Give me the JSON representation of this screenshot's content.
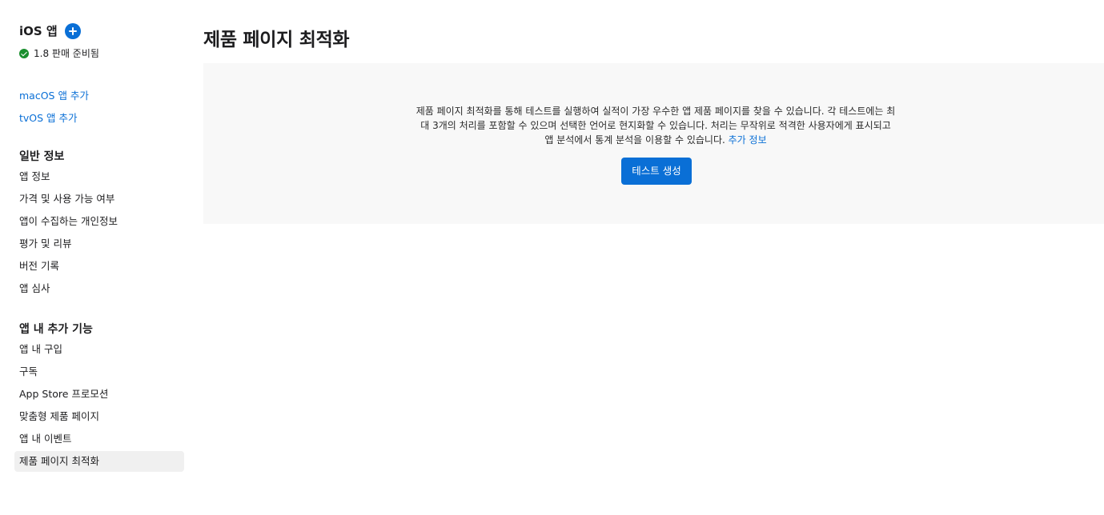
{
  "sidebar": {
    "app_title": "iOS 앱",
    "add_button_icon": "plus-circle-icon",
    "status": {
      "icon": "check-circle-icon",
      "text": "1.8 판매 준비됨"
    },
    "links": [
      {
        "label": "macOS 앱 추가"
      },
      {
        "label": "tvOS 앱 추가"
      }
    ],
    "general": {
      "title": "일반 정보",
      "items": [
        {
          "label": "앱 정보"
        },
        {
          "label": "가격 및 사용 가능 여부"
        },
        {
          "label": "앱이 수집하는 개인정보"
        },
        {
          "label": "평가 및 리뷰"
        },
        {
          "label": "버전 기록"
        },
        {
          "label": "앱 심사"
        }
      ]
    },
    "features": {
      "title": "앱 내 추가 기능",
      "items": [
        {
          "label": "앱 내 구입"
        },
        {
          "label": "구독"
        },
        {
          "label": "App Store 프로모션"
        },
        {
          "label": "맞춤형 제품 페이지"
        },
        {
          "label": "앱 내 이벤트"
        },
        {
          "label": "제품 페이지 최적화",
          "active": true
        }
      ]
    }
  },
  "main": {
    "title": "제품 페이지 최적화",
    "panel": {
      "description": "제품 페이지 최적화를 통해 테스트를 실행하여 실적이 가장 우수한 앱 제품 페이지를 찾을 수 있습니다. 각 테스트에는 최대 3개의 처리를 포함할 수 있으며 선택한 언어로 현지화할 수 있습니다. 처리는 무작위로 적격한 사용자에게 표시되고 앱 분석에서 통계 분석을 이용할 수 있습니다.",
      "more_link": "추가 정보",
      "button_label": "테스트 생성"
    }
  },
  "colors": {
    "accent": "#0a6fd6",
    "success": "#1a8f2e",
    "panel_bg": "#f8f8f8",
    "active_bg": "#f0f0f0"
  }
}
